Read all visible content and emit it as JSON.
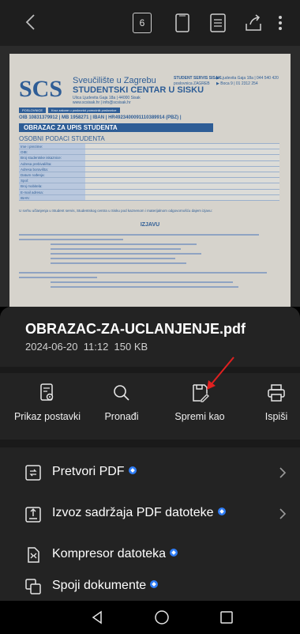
{
  "toolbar": {
    "page_number": "6",
    "icons": [
      "back-arrow-icon",
      "page-number-icon",
      "single-page-view-icon",
      "reading-mode-icon",
      "share-icon",
      "more-vertical-icon"
    ]
  },
  "document_preview": {
    "logo": "SCS",
    "institution_line1": "Sveučilište u Zagrebu",
    "institution_line2": "STUDENTSKI CENTAR U SISKU",
    "institution_line3": "Ulica Ljudevita Gaja 18a | 44000 Sisak",
    "institution_line4": "www.scsisak.hr | info@scsisak.hr",
    "header_right1": "STUDENT SERVIS SISAK",
    "header_right2": "poslovnica ZAGREB",
    "header_right3": "▶ Ljudevita Gaja 18a | 044 540 420",
    "header_right4": "▶ Boca 9 | 01 2312 254",
    "chips": [
      "POSLOVNICE",
      "Kroz zakone u poslovnici pomoćnik poslovnice"
    ],
    "oib_line": "OIB 10831379912 | MB 1958271 | IBAN | HR4923400091110389914 (PBZ) |",
    "form_title": "OBRAZAC ZA UPIS STUDENTA",
    "section_title": "OSOBNI PODACI STUDENTA",
    "fields": [
      "Ime i prezime:",
      "OIB:",
      "Broj studentske iskaznice:",
      "Adresa prebivališta:",
      "Adresa boravišta:",
      "Datum rođenja:",
      "Spol:",
      "Broj mobitela:",
      "E-mail adresa:",
      "IBAN:"
    ],
    "note": "U svrhu učlanjenja u Student servis, Studentskog centra u Sisku pod kaznenom i materijalnom odgovornošću dajem izjavu:",
    "declaration_title": "IZJAVU"
  },
  "file": {
    "name": "OBRAZAC-ZA-UCLANJENJE.pdf",
    "date": "2024-06-20",
    "time": "11:12",
    "size": "150 KB"
  },
  "actions": [
    {
      "label": "Prikaz postavki",
      "icon": "view-settings-icon"
    },
    {
      "label": "Pronađi",
      "icon": "search-icon"
    },
    {
      "label": "Spremi kao",
      "icon": "save-as-icon"
    },
    {
      "label": "Ispiši",
      "icon": "print-icon"
    }
  ],
  "menu": [
    {
      "label": "Pretvori PDF",
      "icon": "convert-pdf-icon",
      "has_chevron": true
    },
    {
      "label": "Izvoz sadržaja PDF datoteke",
      "icon": "export-content-icon",
      "has_chevron": true
    },
    {
      "label": "Kompresor datoteka",
      "icon": "compress-icon",
      "has_chevron": false
    },
    {
      "label": "Spoji dokumente",
      "icon": "merge-documents-icon",
      "has_chevron": false
    }
  ],
  "navbar": [
    "back-triangle-icon",
    "home-circle-icon",
    "recents-square-icon"
  ],
  "colors": {
    "sheet_bg": "#232323",
    "toolbar_bg": "#1e1e1e",
    "badge_blue": "#2f7df6",
    "annotation_red": "#e02020",
    "scs_blue": "#2e5d96"
  }
}
